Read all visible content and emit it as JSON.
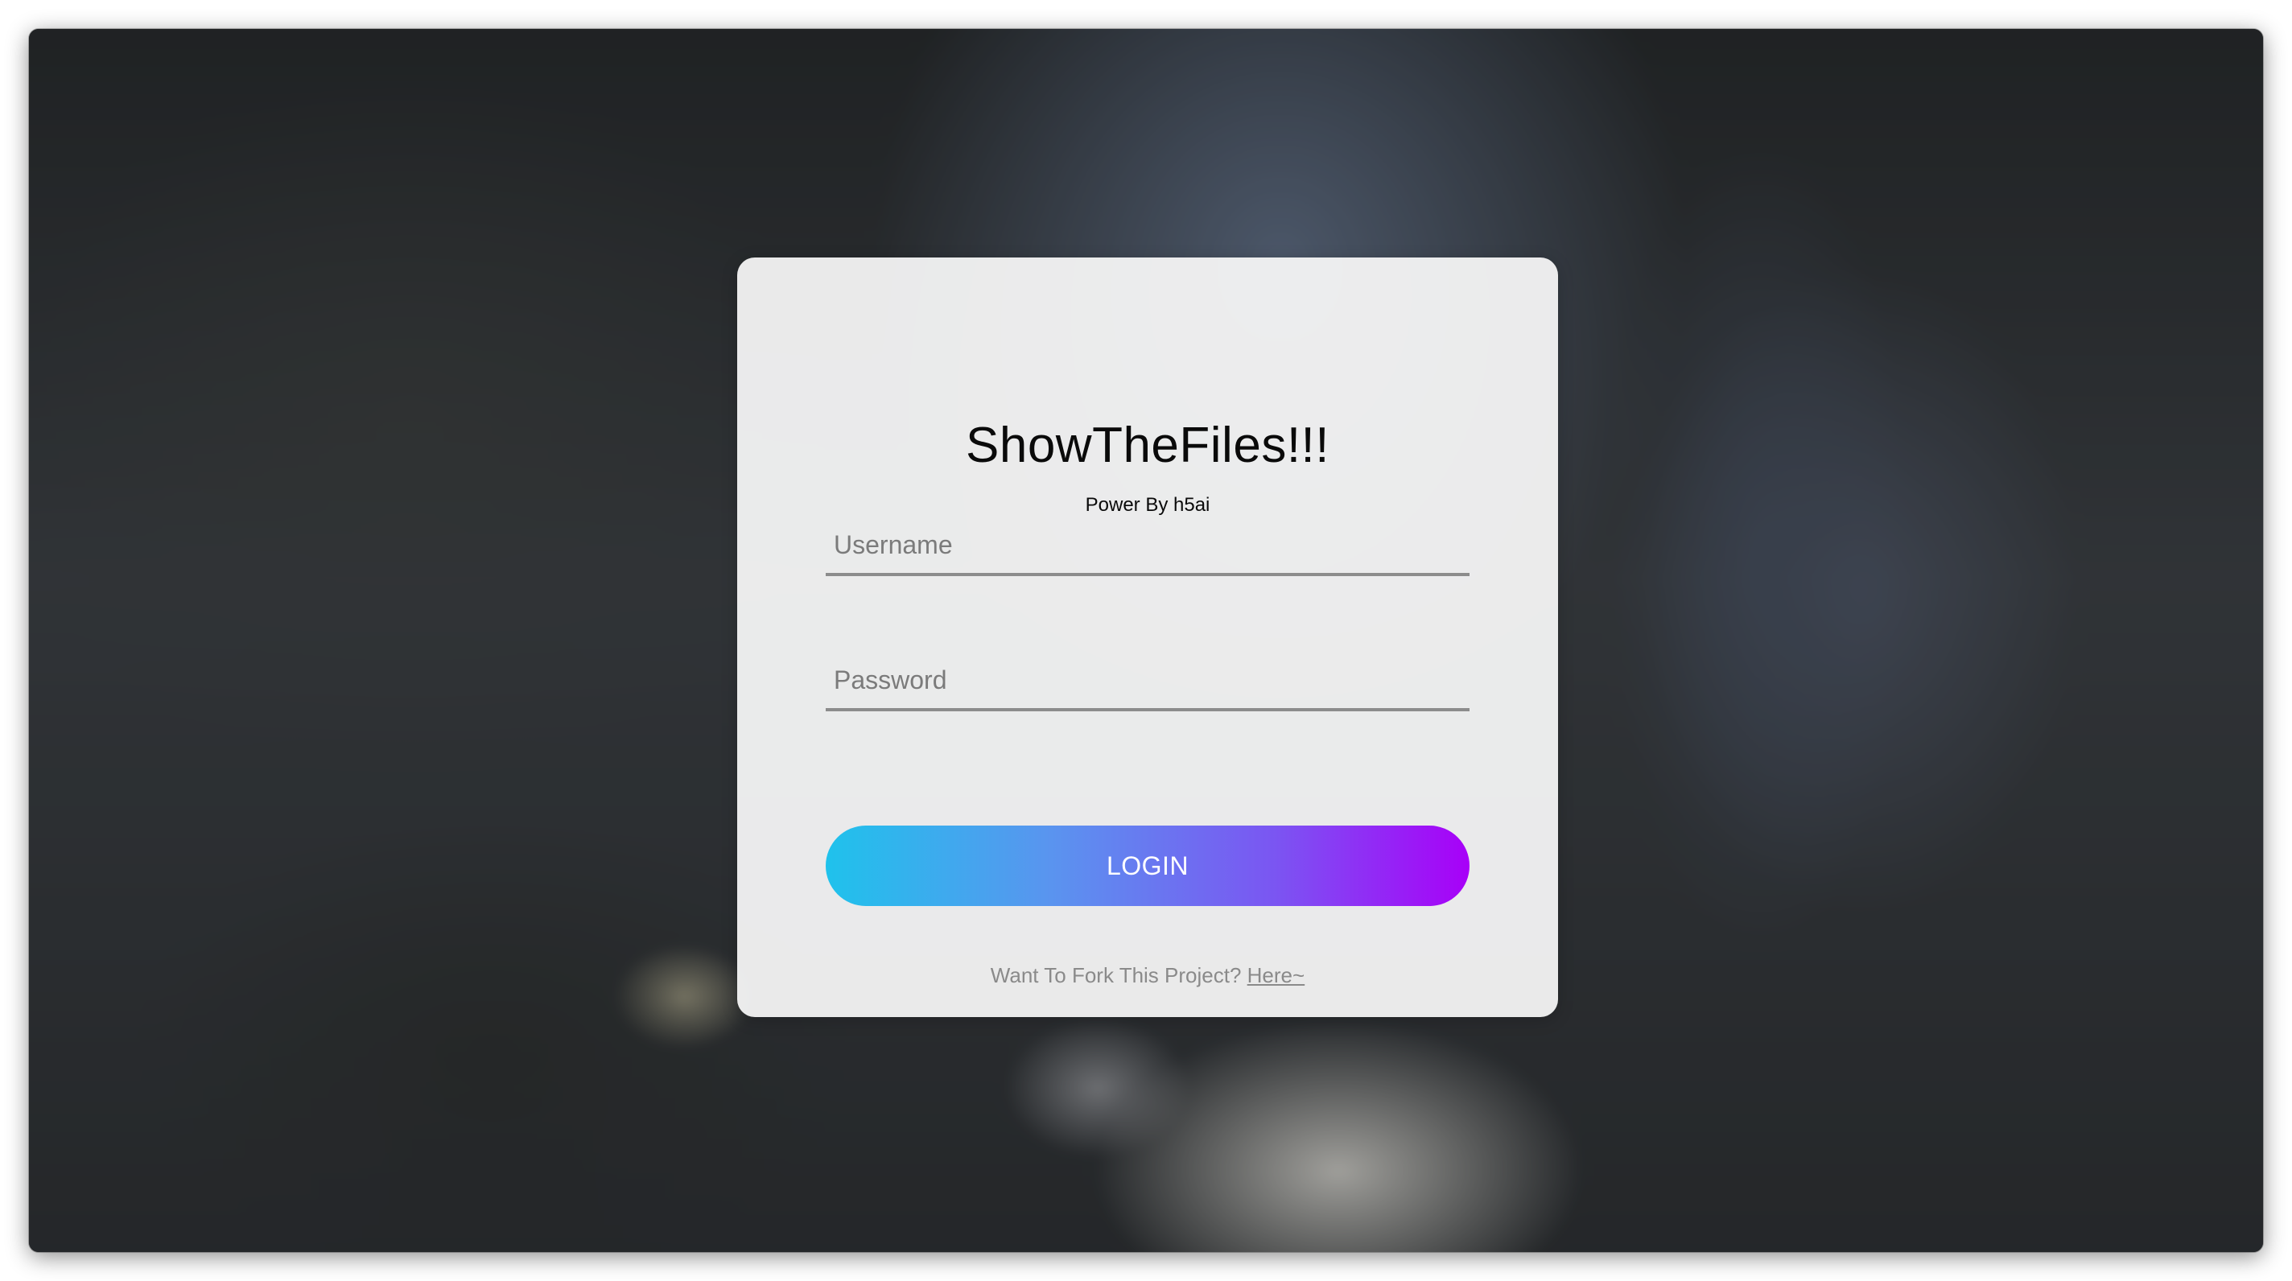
{
  "login": {
    "title": "ShowTheFiles!!!",
    "subtitle": "Power By h5ai",
    "username_placeholder": "Username",
    "password_placeholder": "Password",
    "login_label": "LOGIN",
    "fork_text": "Want To Fork This Project?",
    "fork_link": "Here~"
  },
  "colors": {
    "button_gradient_start": "#1fc2ec",
    "button_gradient_end": "#a800f8",
    "card_background": "#f6f6f7"
  }
}
